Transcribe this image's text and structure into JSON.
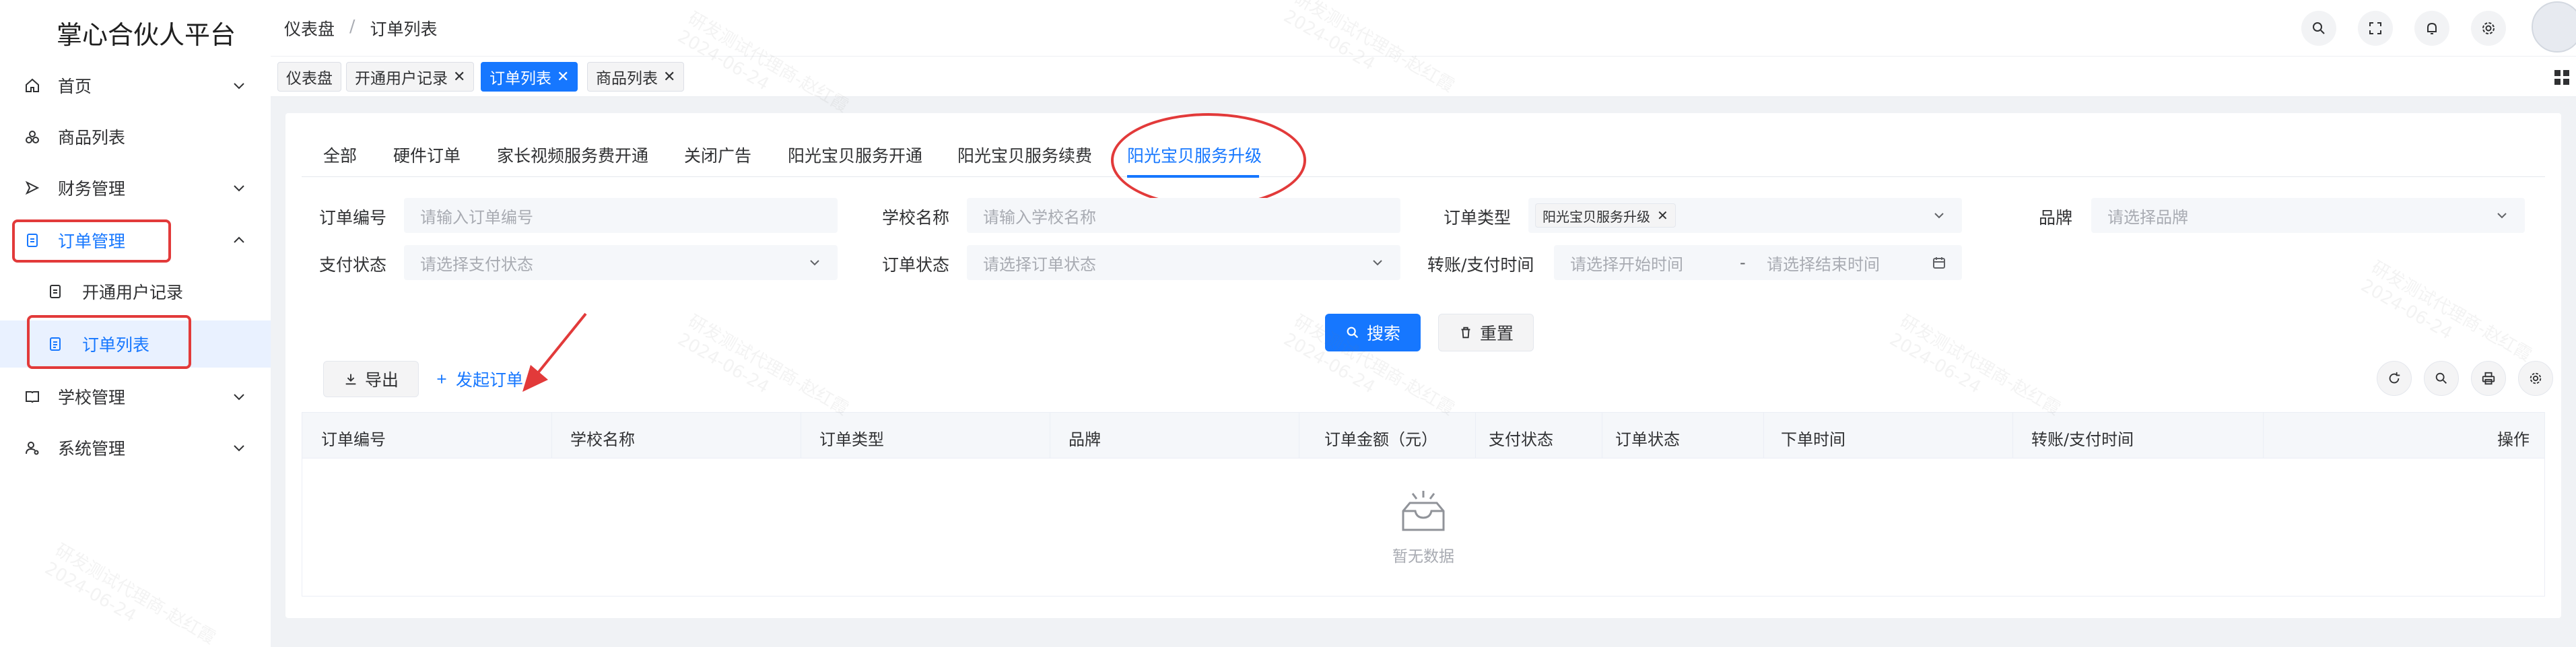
{
  "app": {
    "title": "掌心合伙人平台"
  },
  "sidebar": {
    "items": [
      {
        "label": "首页",
        "icon": "home-icon",
        "has_children": true
      },
      {
        "label": "商品列表",
        "icon": "goods-icon",
        "has_children": false
      },
      {
        "label": "财务管理",
        "icon": "finance-icon",
        "has_children": true
      },
      {
        "label": "订单管理",
        "icon": "order-icon",
        "has_children": true,
        "expanded": true
      },
      {
        "label": "开通用户记录",
        "icon": "doc-icon",
        "sub": true
      },
      {
        "label": "订单列表",
        "icon": "list-icon",
        "sub": true,
        "active": true
      },
      {
        "label": "学校管理",
        "icon": "school-icon",
        "has_children": true
      },
      {
        "label": "系统管理",
        "icon": "user-settings-icon",
        "has_children": true
      }
    ]
  },
  "header": {
    "breadcrumb": [
      "仪表盘",
      "订单列表"
    ],
    "breadcrumb_sep": "/",
    "icons": [
      "search-icon",
      "fullscreen-icon",
      "bell-icon",
      "gear-icon"
    ]
  },
  "tags": [
    {
      "label": "仪表盘",
      "closable": false
    },
    {
      "label": "开通用户记录",
      "closable": true
    },
    {
      "label": "订单列表",
      "closable": true,
      "active": true
    },
    {
      "label": "商品列表",
      "closable": true
    }
  ],
  "order_tabs": [
    "全部",
    "硬件订单",
    "家长视频服务费开通",
    "关闭广告",
    "阳光宝贝服务开通",
    "阳光宝贝服务续费",
    "阳光宝贝服务升级"
  ],
  "active_tab": "阳光宝贝服务升级",
  "filters": {
    "order_no": {
      "label": "订单编号",
      "placeholder": "请输入订单编号"
    },
    "school": {
      "label": "学校名称",
      "placeholder": "请输入学校名称"
    },
    "order_type": {
      "label": "订单类型",
      "value": "阳光宝贝服务升级"
    },
    "brand": {
      "label": "品牌",
      "placeholder": "请选择品牌"
    },
    "pay_status": {
      "label": "支付状态",
      "placeholder": "请选择支付状态"
    },
    "order_status": {
      "label": "订单状态",
      "placeholder": "请选择订单状态"
    },
    "pay_time": {
      "label": "转账/支付时间",
      "start_placeholder": "请选择开始时间",
      "range_sep": "-",
      "end_placeholder": "请选择结束时间"
    }
  },
  "actions": {
    "search": "搜索",
    "reset": "重置",
    "export": "导出",
    "create": "发起订单"
  },
  "table": {
    "columns": [
      "订单编号",
      "学校名称",
      "订单类型",
      "品牌",
      "订单金额（元）",
      "支付状态",
      "订单状态",
      "下单时间",
      "转账/支付时间",
      "操作"
    ],
    "empty_text": "暂无数据"
  },
  "watermark": {
    "line1": "研发测试代理商-赵红霞",
    "line2": "2024-06-24"
  },
  "colors": {
    "primary": "#1677ff",
    "annotation": "#e23a3a"
  }
}
